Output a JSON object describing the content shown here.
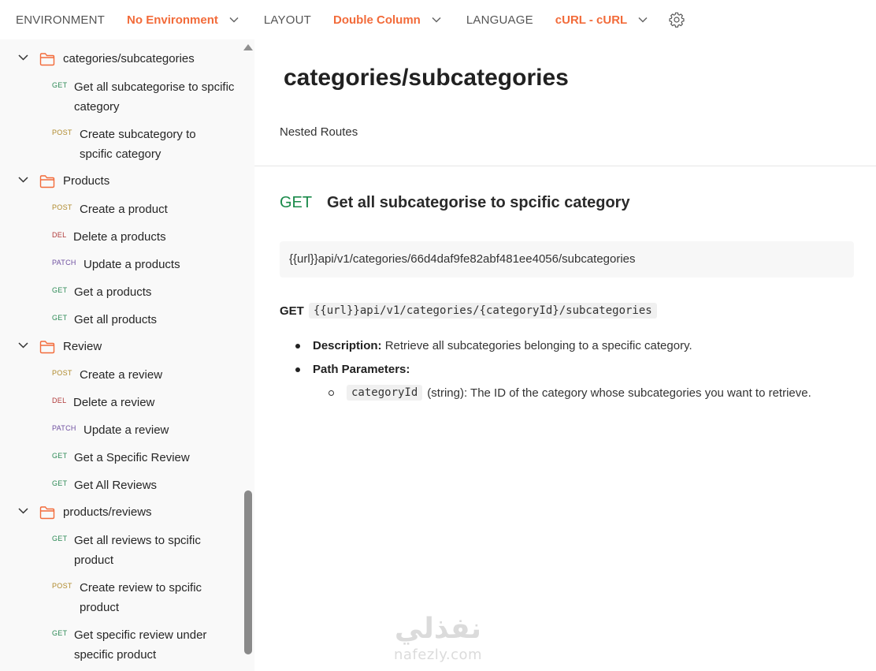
{
  "topbar": {
    "environment_label": "ENVIRONMENT",
    "environment_value": "No Environment",
    "layout_label": "LAYOUT",
    "layout_value": "Double Column",
    "language_label": "LANGUAGE",
    "language_value": "cURL - cURL",
    "icons": [
      "chevron-down-icon",
      "gear-icon"
    ],
    "accent_color": "#f26b3a"
  },
  "sidebar": {
    "folders": [
      {
        "name": "categories/subcategories",
        "requests": [
          {
            "method": "GET",
            "label": "Get all subcategorise to spcific category"
          },
          {
            "method": "POST",
            "label": "Create subcategory to spcific category"
          }
        ]
      },
      {
        "name": "Products",
        "requests": [
          {
            "method": "POST",
            "label": "Create a product"
          },
          {
            "method": "DEL",
            "label": "Delete a products"
          },
          {
            "method": "PATCH",
            "label": "Update a products"
          },
          {
            "method": "GET",
            "label": "Get a products"
          },
          {
            "method": "GET",
            "label": "Get all products"
          }
        ]
      },
      {
        "name": "Review",
        "requests": [
          {
            "method": "POST",
            "label": "Create a review"
          },
          {
            "method": "DEL",
            "label": "Delete a review"
          },
          {
            "method": "PATCH",
            "label": "Update a review"
          },
          {
            "method": "GET",
            "label": "Get a Specific Review"
          },
          {
            "method": "GET",
            "label": "Get All Reviews"
          }
        ]
      },
      {
        "name": "products/reviews",
        "requests": [
          {
            "method": "GET",
            "label": "Get all reviews to spcific product"
          },
          {
            "method": "POST",
            "label": "Create review to spcific product"
          },
          {
            "method": "GET",
            "label": "Get specific review under specific product"
          }
        ]
      }
    ]
  },
  "main": {
    "title": "categories/subcategories",
    "subtitle": "Nested Routes",
    "endpoint": {
      "method": "GET",
      "title": "Get all subcategorise to spcific category",
      "url": "{{url}}api/v1/categories/66d4daf9fe82abf481ee4056/subcategories"
    },
    "doc": {
      "method": "GET",
      "path": "{{url}}api/v1/categories/{categoryId}/subcategories",
      "description_label": "Description:",
      "description_text": "Retrieve all subcategories belonging to a specific category.",
      "params_label": "Path Parameters:",
      "param_name": "categoryId",
      "param_text": "(string): The ID of the category whose subcategories you want to retrieve."
    }
  },
  "watermark": {
    "arabic": "نفذلي",
    "latin": "nafezly.com"
  }
}
